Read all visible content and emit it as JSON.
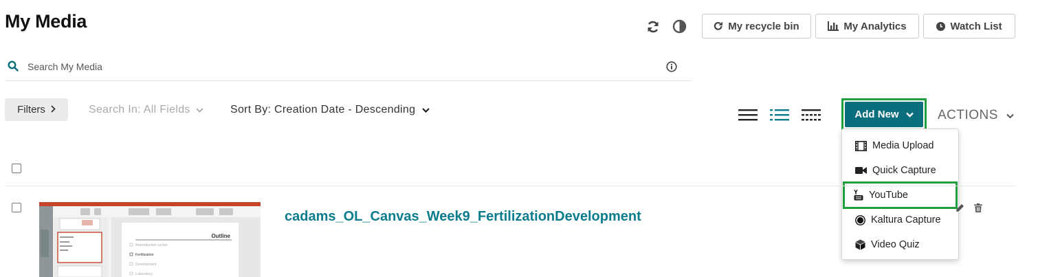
{
  "page": {
    "title": "My Media"
  },
  "top_buttons": {
    "recycle_bin": "My recycle bin",
    "analytics": "My Analytics",
    "watch_list": "Watch List"
  },
  "search": {
    "placeholder": "Search My Media",
    "value": ""
  },
  "toolbar": {
    "filters_label": "Filters",
    "search_in_label": "Search In: All Fields",
    "sort_by_label": "Sort By: Creation Date - Descending",
    "add_new_label": "Add New",
    "actions_label": "ACTIONS"
  },
  "add_new_menu": {
    "items": [
      {
        "label": "Media Upload",
        "icon": "film-icon"
      },
      {
        "label": "Quick Capture",
        "icon": "video-camera-icon"
      },
      {
        "label": "YouTube",
        "icon": "youtube-icon"
      },
      {
        "label": "Kaltura Capture",
        "icon": "record-icon"
      },
      {
        "label": "Video Quiz",
        "icon": "cube-icon"
      }
    ],
    "highlighted": "YouTube"
  },
  "entries": [
    {
      "title": "cadams_OL_Canvas_Week9_FertilizationDevelopment",
      "thumbnail_slide": {
        "heading": "Outline",
        "bullets": [
          "Reproductive cycles",
          "Fertilization",
          "Development",
          "Laboratory"
        ]
      }
    }
  ],
  "colors": {
    "accent_teal": "#0a6e7d",
    "link_teal": "#0a7c8c",
    "highlight_green": "#1e9e3c",
    "slide_ribbon": "#c5452c"
  }
}
